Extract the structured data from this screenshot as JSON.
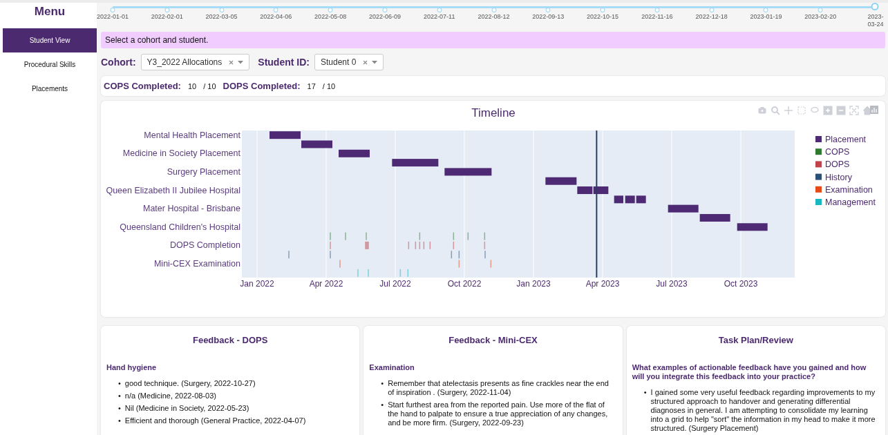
{
  "sidebar": {
    "title": "Menu",
    "items": [
      {
        "label": "Student View",
        "selected": true
      },
      {
        "label": "Procedural Skills",
        "selected": false
      },
      {
        "label": "Placements",
        "selected": false
      }
    ]
  },
  "date_slider": {
    "level": 1,
    "marks": [
      "2022-01-01",
      "2022-02-01",
      "2022-03-05",
      "2022-04-06",
      "2022-05-08",
      "2022-06-09",
      "2022-07-11",
      "2022-08-12",
      "2022-09-13",
      "2022-10-15",
      "2022-11-16",
      "2022-12-18",
      "2023-01-19",
      "2023-02-20",
      "2023-03-24"
    ]
  },
  "alert": "Select a cohort and student.",
  "filters": [
    {
      "label": "Cohort:",
      "value": "Y3_2022 Allocations"
    },
    {
      "label": "Student ID:",
      "value": "Student 0"
    }
  ],
  "completion": [
    {
      "label": "COPS Completed:",
      "count": "10",
      "total": "/ 10"
    },
    {
      "label": "DOPS Completed:",
      "count": "17",
      "total": "/ 10"
    }
  ],
  "timeline": {
    "title": "Timeline",
    "row_labels": [
      "Mental Health Placement",
      "Medicine in Society Placement",
      "Surgery Placement",
      "Queen Elizabeth II Jubilee Hospital",
      "Mater Hospital - Brisbane",
      "Queensland Children's Hospital",
      "DOPS Completion",
      "Mini-CEX Examination"
    ],
    "x_labels": [
      "Jan 2022",
      "Apr 2022",
      "Jul 2022",
      "Oct 2022",
      "Jan 2023",
      "Apr 2023",
      "Jul 2023",
      "Oct 2023"
    ],
    "legend": [
      {
        "name": "Placement",
        "color": "#4d2a73"
      },
      {
        "name": "COPS",
        "color": "#2e7a2e"
      },
      {
        "name": "DOPS",
        "color": "#c0424a"
      },
      {
        "name": "History",
        "color": "#2b4f75"
      },
      {
        "name": "Examination",
        "color": "#e64a19"
      },
      {
        "name": "Management",
        "color": "#17b8c0"
      }
    ]
  },
  "feedback_panels": [
    {
      "title": "Feedback - DOPS",
      "sections": [
        {
          "heading": "Hand hygiene",
          "bullet": "•",
          "items": [
            "good technique. (Surgery, 2022-10-27)",
            "n/a (Medicine, 2022-08-03)",
            "Nil (Medicine in Society, 2022-05-23)",
            "Efficient and thorough (General Practice, 2022-04-07)"
          ]
        }
      ]
    },
    {
      "title": "Feedback - Mini-CEX",
      "sections": [
        {
          "heading": "Examination",
          "bullet": "•",
          "items": [
            "Remember that atelectasis presents as fine crackles near the end of inspiration . (Surgery, 2022-11-04)",
            "Start furthest area from the reported pain. Use more of the flat of the hand to palpate to ensure a true appreciation of any changes, and be more firm. (Surgery, 2022-09-23)"
          ]
        }
      ]
    },
    {
      "title": "Task Plan/Review",
      "sections": [
        {
          "heading": "What examples of actionable feedback have you gained and how will you integrate this feedback into your practice?",
          "bullet": "•",
          "items": [
            "I gained some very useful feedback regarding improvements to my structured approach to handover and generating differential diagnoses in general. I am attempting to consolidate my learning into a grid to help \"sort\" the information in my head to make it more structured. (Surgery Placement)"
          ]
        }
      ]
    }
  ]
}
